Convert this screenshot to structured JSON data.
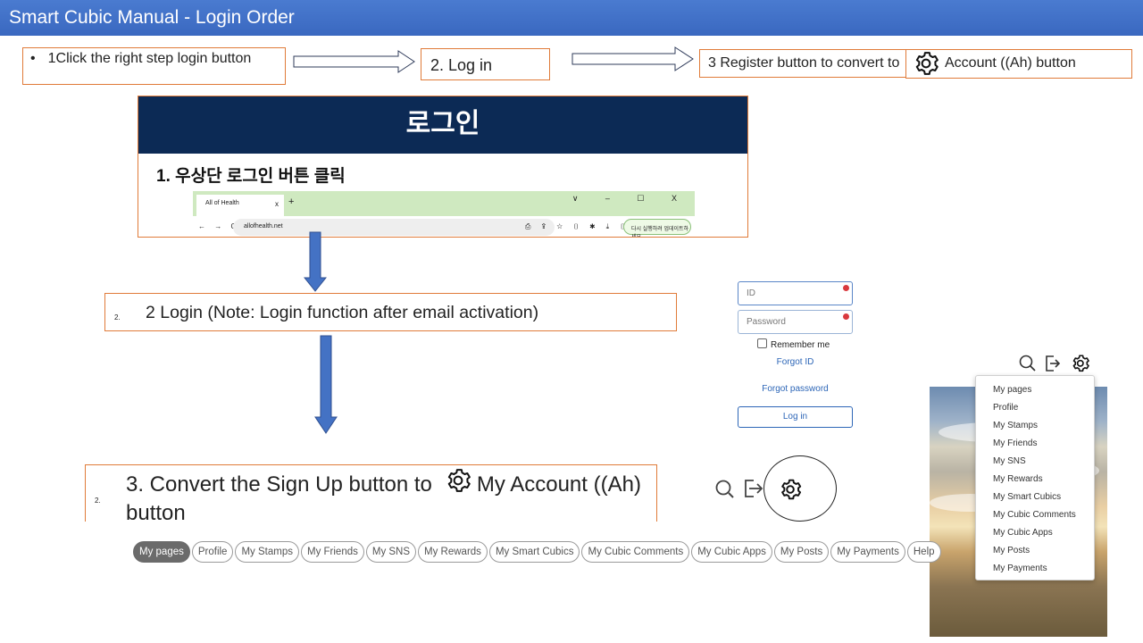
{
  "title": "Smart Cubic Manual - Login Order",
  "steps": {
    "step1_bullet": "•",
    "step1": "1Click the right step login button",
    "step2": "2. Log in",
    "step3": "3 Register button to convert to",
    "step3_suffix": "Account ((Ah) button"
  },
  "screenshot": {
    "heading": "로그인",
    "subheading": "1. 우상단 로그인 버튼 클릭",
    "tab_label": "All of Health",
    "tab_close": "x",
    "new_tab": "+",
    "window_controls": "∨ – ☐ X",
    "nav_buttons": "← → C",
    "url": "allofhealth.net",
    "right_pill": "다시 실행하려 업데이트하세요"
  },
  "login_note": {
    "number": "2.",
    "text": "2 Login (Note: Login function after email activation)"
  },
  "convert_note": {
    "number": "2.",
    "text_before": "3. Convert the Sign Up button to",
    "text_after": "My Account ((Ah)",
    "text_line2": "button"
  },
  "login_form": {
    "id_placeholder": "ID",
    "password_placeholder": "Password",
    "remember_label": "Remember me",
    "forgot_id": "Forgot ID",
    "forgot_password": "Forgot password",
    "login_button": "Log in"
  },
  "account_menu": {
    "items": [
      "My pages",
      "Profile",
      "My Stamps",
      "My Friends",
      "My SNS",
      "My Rewards",
      "My Smart Cubics",
      "My Cubic Comments",
      "My Cubic Apps",
      "My Posts",
      "My Payments"
    ]
  },
  "tabs": {
    "items": [
      "My pages",
      "Profile",
      "My Stamps",
      "My Friends",
      "My SNS",
      "My Rewards",
      "My Smart Cubics",
      "My Cubic Comments",
      "My Cubic Apps",
      "My Posts",
      "My Payments",
      "Help"
    ],
    "active": "My pages"
  },
  "colors": {
    "title_bar": "#3a68c0",
    "box_border": "#e07b39",
    "arrow_fill": "#4472c4",
    "screenshot_header": "#0c2a55",
    "link": "#2d66b7"
  }
}
